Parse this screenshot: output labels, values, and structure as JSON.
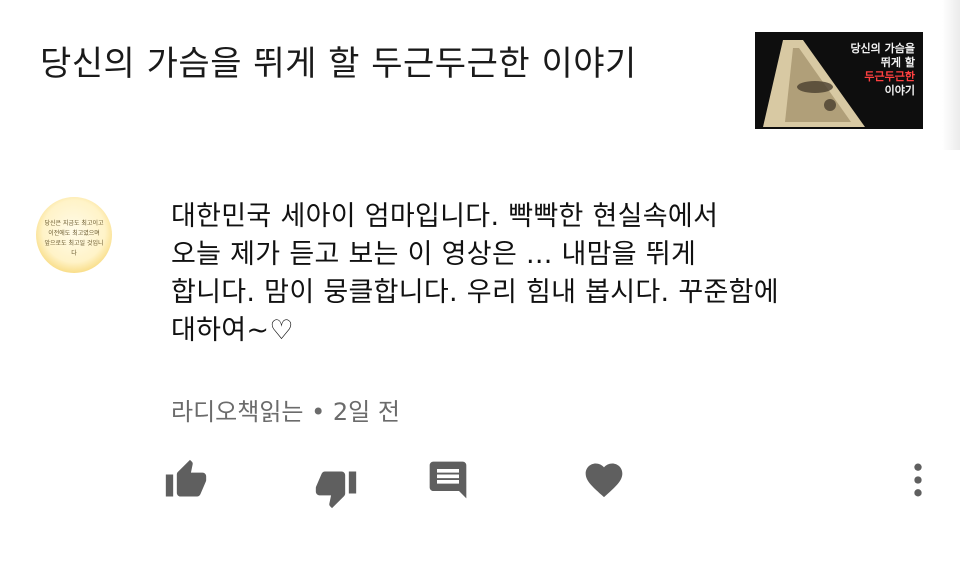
{
  "video": {
    "title": "당신의 가슴을 뛰게 할 두근두근한 이야기",
    "thumbnail_lines": [
      "당신의 가슴을",
      "뛰게 할",
      "두근두근한",
      "이야기"
    ]
  },
  "avatar_text": [
    "당신은 지금도 최고이고",
    "이전에도 최고였으며",
    "앞으로도 최고일 것입니다"
  ],
  "comment": {
    "lines": [
      "대한민국 세아이 엄마입니다. 빡빡한 현실속에서",
      "오늘 제가 듣고 보는 이 영상은 ... 내맘을 뛰게",
      "합니다. 맘이 뭉클합니다. 우리 힘내 봅시다. 꾸준함에",
      "대하여~♡"
    ],
    "meta": "라디오책읽는 • 2일 전"
  },
  "actions": [
    {
      "name": "like-icon"
    },
    {
      "name": "dislike-icon"
    },
    {
      "name": "reply-icon"
    },
    {
      "name": "heart-icon"
    },
    {
      "name": "more-vert-icon"
    }
  ],
  "colors": {
    "icon": "#5f5f5f",
    "meta": "#6b6b6b",
    "thumbnail_highlight": "#ff4040"
  }
}
